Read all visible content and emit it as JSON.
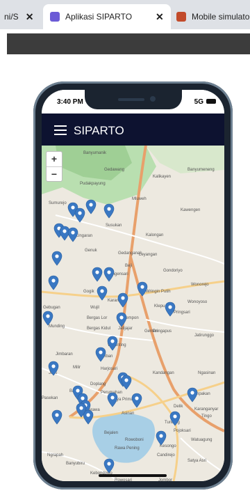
{
  "browser": {
    "tabs": [
      {
        "label": "ni/S",
        "favicon": "page-icon"
      },
      {
        "label": "Aplikasi SIPARTO",
        "favicon": "shield-icon",
        "active": true
      },
      {
        "label": "Mobile simulato",
        "favicon": "castle-icon"
      }
    ]
  },
  "phone": {
    "status": {
      "time": "3:40 PM",
      "network": "5G"
    }
  },
  "app": {
    "title": "SIPARTO"
  },
  "map": {
    "zoom_in": "+",
    "zoom_out": "−",
    "place_labels": [
      {
        "name": "Banyumanik"
      },
      {
        "name": "Gedawang"
      },
      {
        "name": "Kalikayen"
      },
      {
        "name": "Banyumeneng"
      },
      {
        "name": "Pudakpayung"
      },
      {
        "name": "Sumurejo"
      },
      {
        "name": "Mluweh"
      },
      {
        "name": "Kawengen"
      },
      {
        "name": "Susukan"
      },
      {
        "name": "Ungaran"
      },
      {
        "name": "Kalongan"
      },
      {
        "name": "Genuk"
      },
      {
        "name": "Gedanganak"
      },
      {
        "name": "Leyangan"
      },
      {
        "name": "Beji"
      },
      {
        "name": "Gondoriyo"
      },
      {
        "name": "Langensari"
      },
      {
        "name": "Wonorejo"
      },
      {
        "name": "Gogik"
      },
      {
        "name": "Wringin Putih"
      },
      {
        "name": "Karangjati"
      },
      {
        "name": "Wujil"
      },
      {
        "name": "Klepu"
      },
      {
        "name": "Pringsari"
      },
      {
        "name": "Wonoyoso"
      },
      {
        "name": "Gebugan"
      },
      {
        "name": "Bergas Lor"
      },
      {
        "name": "Lempon"
      },
      {
        "name": "Munding"
      },
      {
        "name": "Bergas Kidul"
      },
      {
        "name": "Jatijajar"
      },
      {
        "name": "Gentan"
      },
      {
        "name": "Pringapus"
      },
      {
        "name": "Jatirunggo"
      },
      {
        "name": "Wujunting"
      },
      {
        "name": "Jimbaran"
      },
      {
        "name": "Samban"
      },
      {
        "name": "Harjosari"
      },
      {
        "name": "Jetis"
      },
      {
        "name": "Milir"
      },
      {
        "name": "Kandangan"
      },
      {
        "name": "Ngasinan"
      },
      {
        "name": "Doplang"
      },
      {
        "name": "Perumahan"
      },
      {
        "name": "Griya Prima"
      },
      {
        "name": "Baran"
      },
      {
        "name": "Pasekan"
      },
      {
        "name": "Ambarawa"
      },
      {
        "name": "Asinan"
      },
      {
        "name": "Bejalen"
      },
      {
        "name": "Delik"
      },
      {
        "name": "Karanganyar"
      },
      {
        "name": "Tompakan"
      },
      {
        "name": "Tingo"
      },
      {
        "name": "Tuntang"
      },
      {
        "name": "Rowoboni"
      },
      {
        "name": "Kesongo"
      },
      {
        "name": "Candirejo"
      },
      {
        "name": "Watuagung"
      },
      {
        "name": "Pojoksari"
      },
      {
        "name": "Rawa Pening"
      },
      {
        "name": "Ngrapah"
      },
      {
        "name": "Banyubiru"
      },
      {
        "name": "Satya Asri"
      },
      {
        "name": "Kebondowo"
      },
      {
        "name": "Rowosari"
      },
      {
        "name": "Kemambang"
      },
      {
        "name": "Jombor"
      },
      {
        "name": "Sidorejo"
      }
    ],
    "marker_count": 38
  },
  "colors": {
    "appbar": "#0d1230",
    "marker": "#3a78c3",
    "road_primary": "#e8a06b",
    "forest": "#a9d8a3",
    "lake": "#a8cfe6"
  }
}
